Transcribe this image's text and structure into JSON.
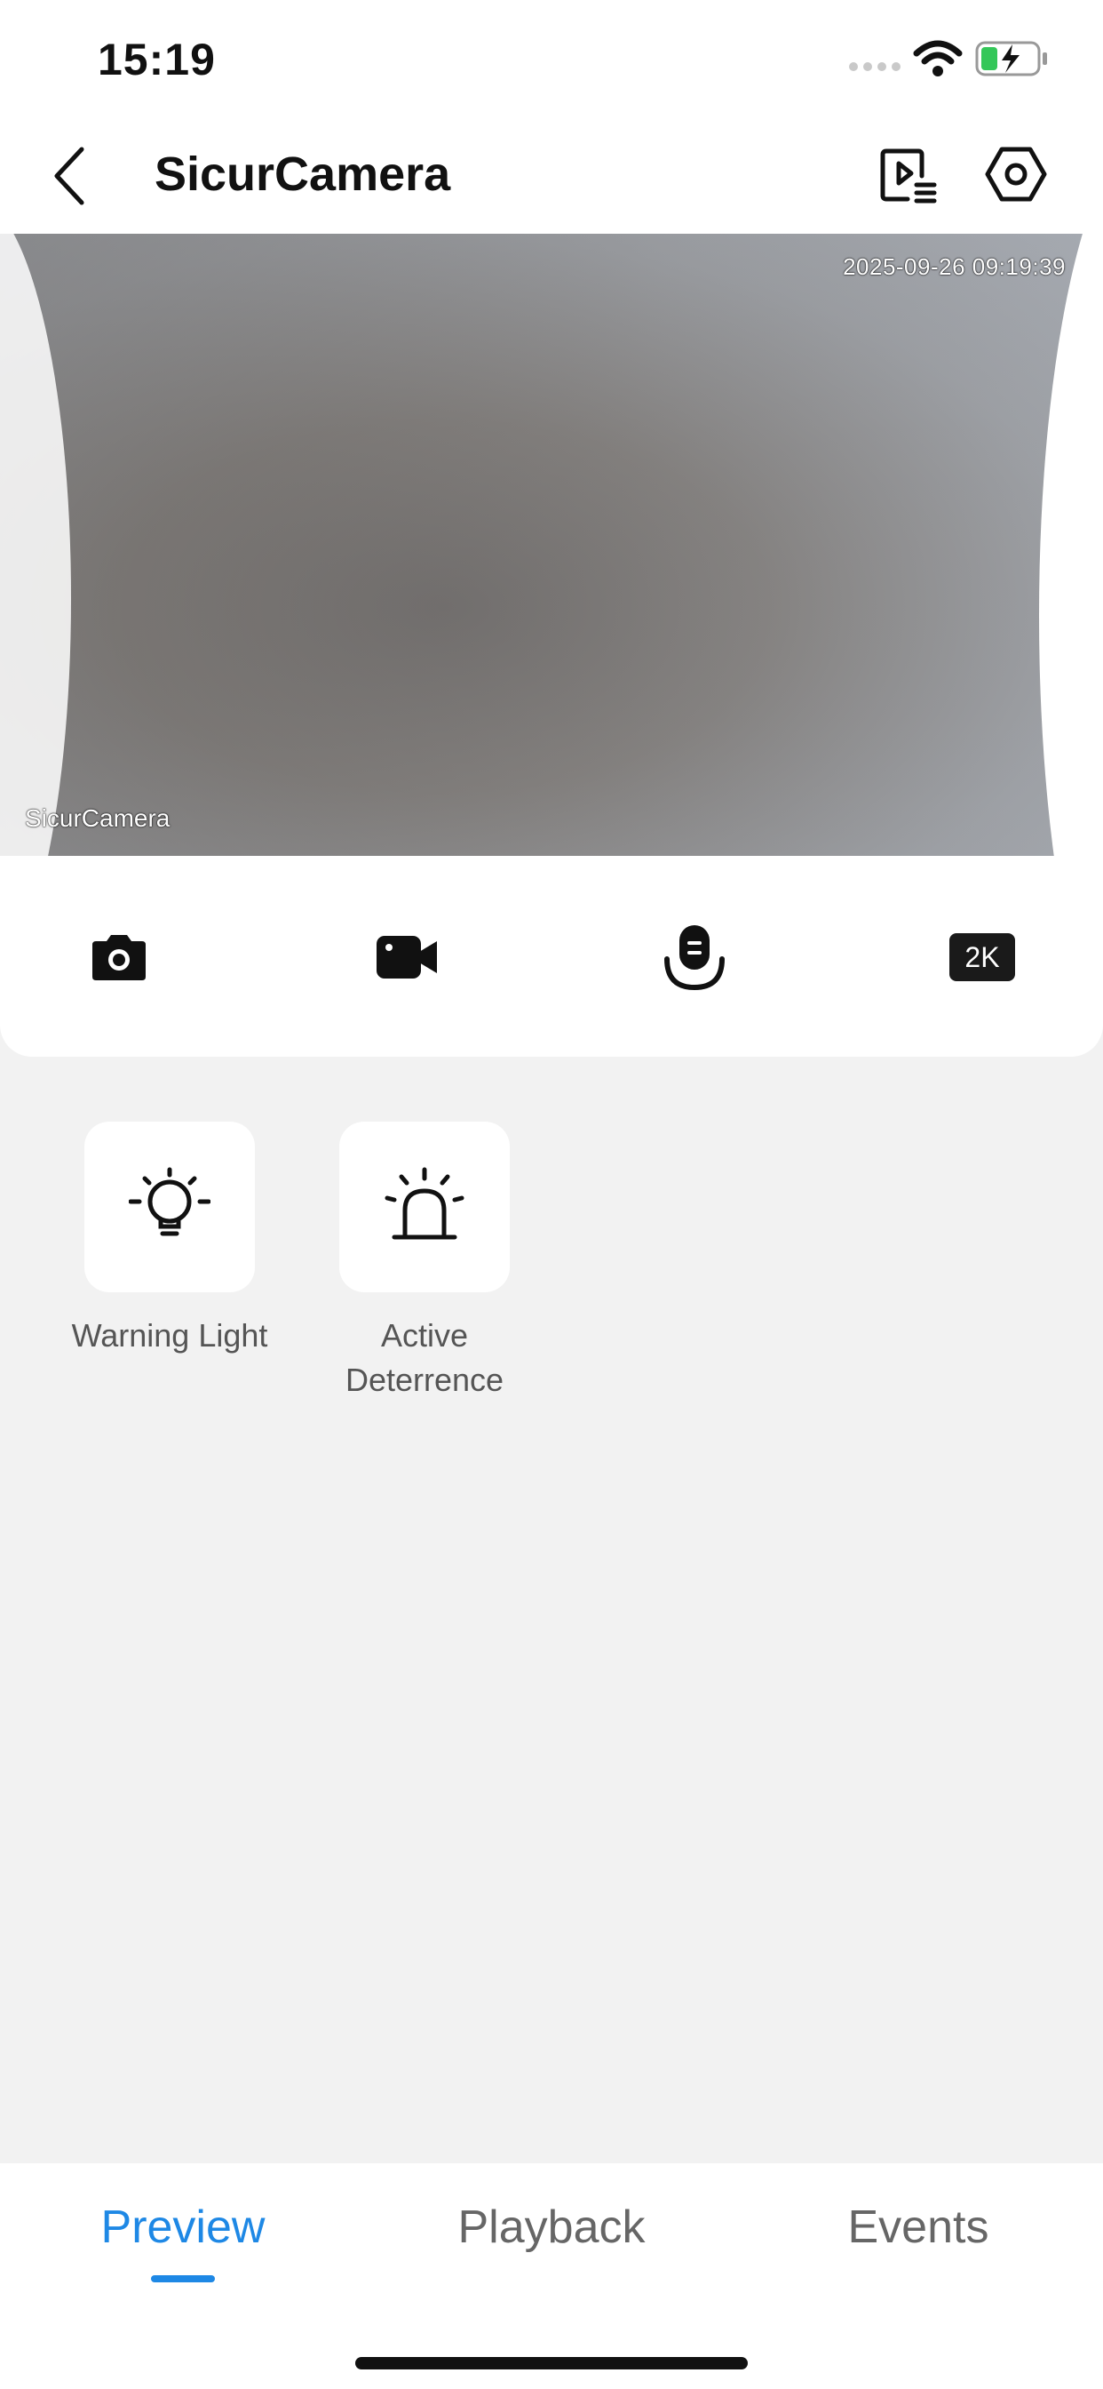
{
  "status_bar": {
    "time": "15:19"
  },
  "header": {
    "title": "SicurCamera"
  },
  "video": {
    "timestamp": "2025-09-26 09:19:39",
    "camera_label": "SicurCamera"
  },
  "controls": {
    "quality_label": "2K"
  },
  "features": [
    {
      "label": "Warning Light"
    },
    {
      "label": "Active\nDeterrence"
    }
  ],
  "tabs": [
    {
      "label": "Preview",
      "active": true
    },
    {
      "label": "Playback",
      "active": false
    },
    {
      "label": "Events",
      "active": false
    }
  ],
  "colors": {
    "accent": "#1e88e5",
    "battery": "#34c759"
  }
}
